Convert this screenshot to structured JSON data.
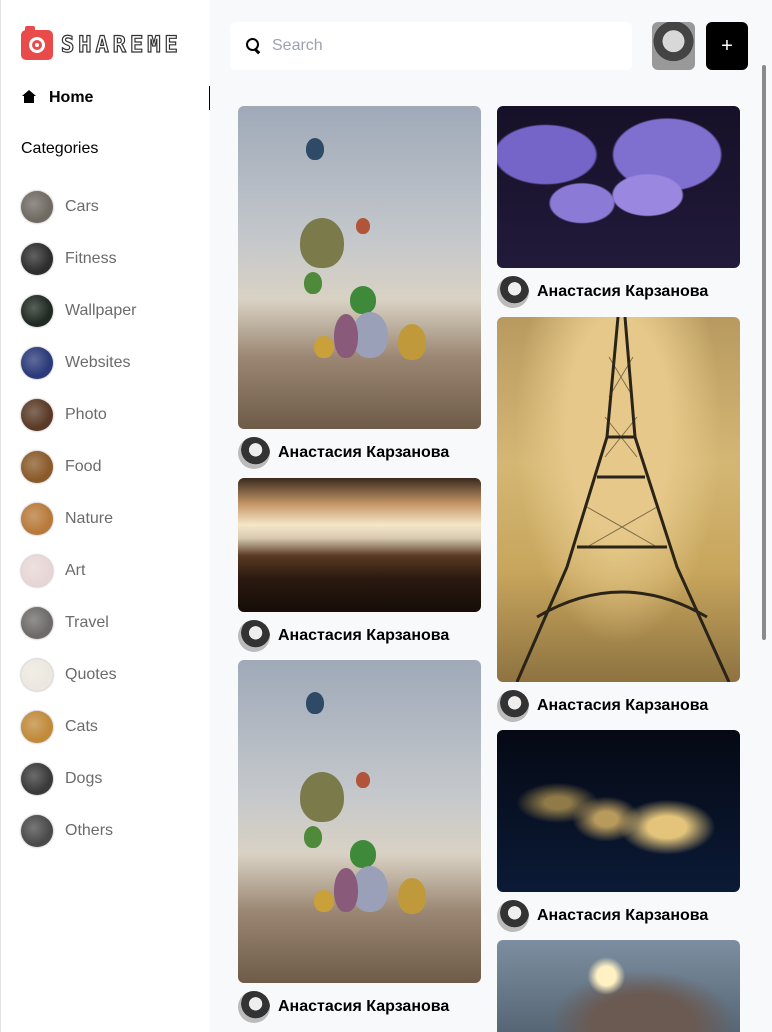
{
  "app": {
    "logo_text": "SHAREME"
  },
  "sidebar": {
    "home_label": "Home",
    "categories_heading": "Categories",
    "categories": [
      {
        "label": "Cars",
        "color": "#6f6a62"
      },
      {
        "label": "Fitness",
        "color": "#2d2d2d"
      },
      {
        "label": "Wallpaper",
        "color": "#1f2a22"
      },
      {
        "label": "Websites",
        "color": "#2a3a7a"
      },
      {
        "label": "Photo",
        "color": "#5a3a26"
      },
      {
        "label": "Food",
        "color": "#8a5a2a"
      },
      {
        "label": "Nature",
        "color": "#b87a3a"
      },
      {
        "label": "Art",
        "color": "#e8d6d6"
      },
      {
        "label": "Travel",
        "color": "#6e6a6a"
      },
      {
        "label": "Quotes",
        "color": "#ece8df"
      },
      {
        "label": "Cats",
        "color": "#c08a3a"
      },
      {
        "label": "Dogs",
        "color": "#3a3a3a"
      },
      {
        "label": "Others",
        "color": "#4a4a4a"
      }
    ]
  },
  "header": {
    "search_placeholder": "Search",
    "add_label": "+"
  },
  "pins": {
    "author": "Анастасия Карзанова",
    "left": [
      {
        "image": "balloons"
      },
      {
        "image": "car-interior"
      },
      {
        "image": "balloons"
      }
    ],
    "right": [
      {
        "image": "world-map-night"
      },
      {
        "image": "eiffel-tower"
      },
      {
        "image": "usa-night"
      },
      {
        "image": "sparkler"
      }
    ]
  }
}
